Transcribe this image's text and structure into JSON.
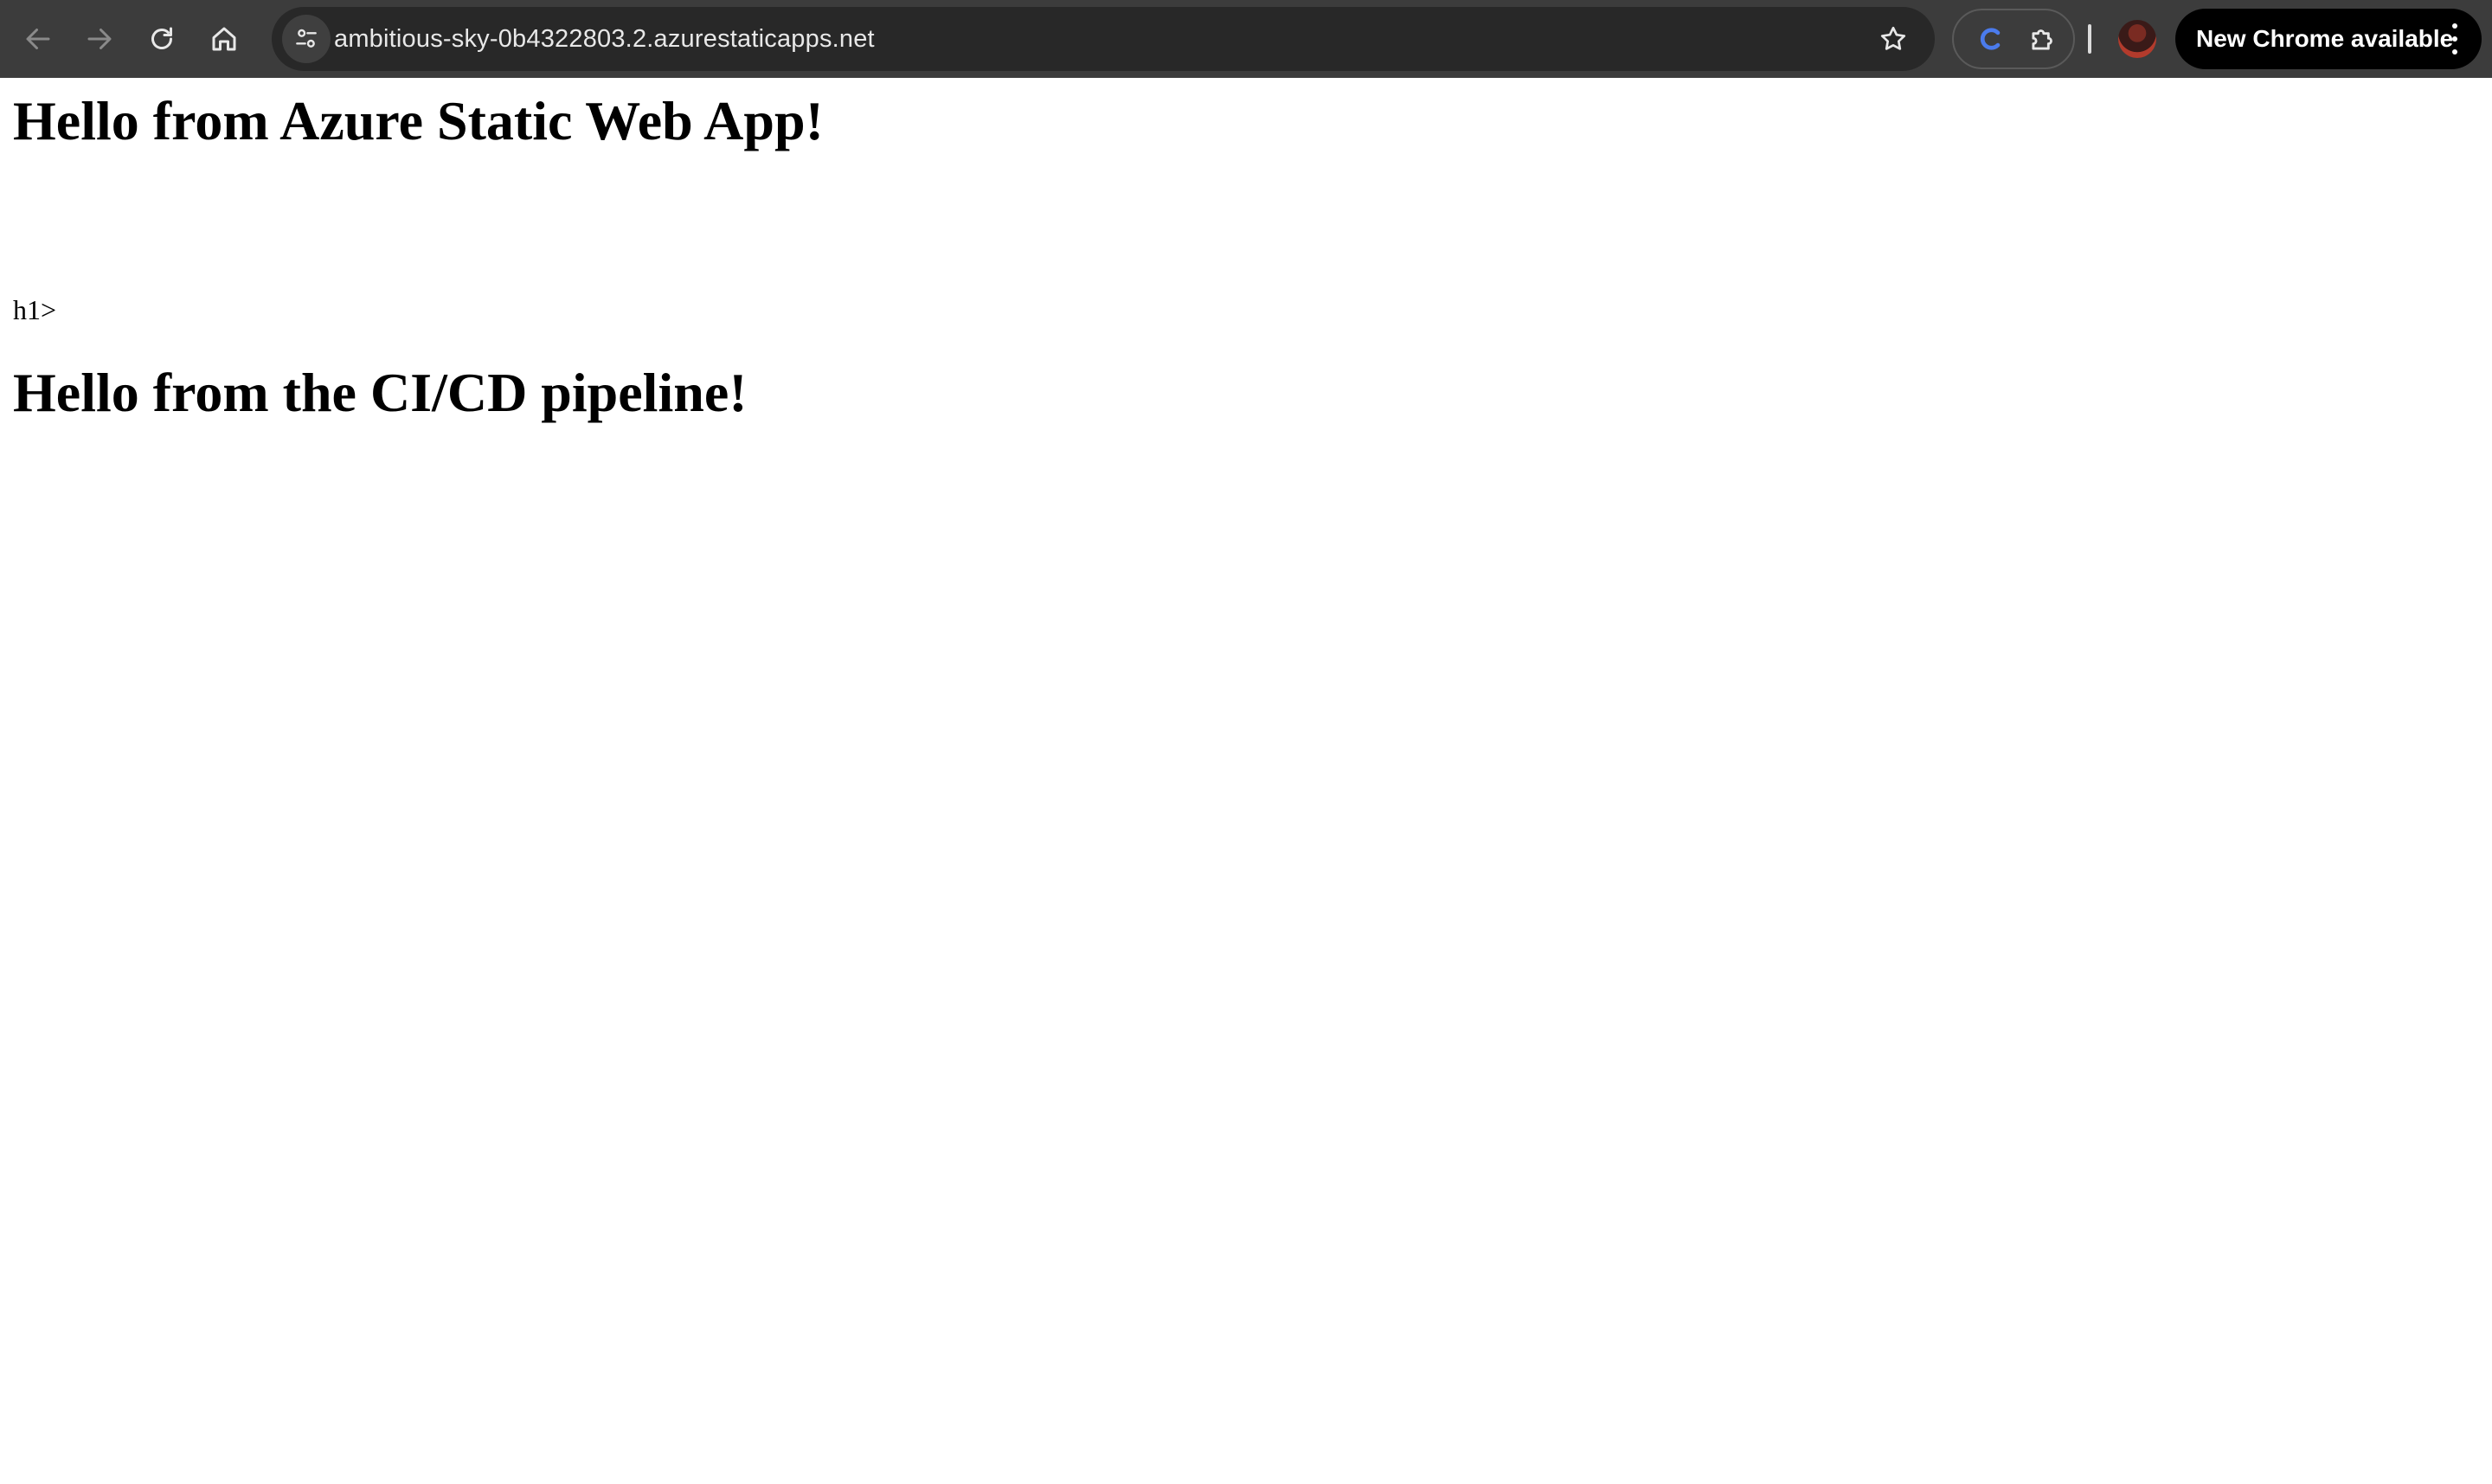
{
  "browser": {
    "url": "ambitious-sky-0b4322803.2.azurestaticapps.net",
    "update_button_label": "New Chrome available",
    "nav": {
      "back_icon": "arrow-left-icon",
      "forward_icon": "arrow-right-icon",
      "reload_icon": "reload-icon",
      "home_icon": "home-icon"
    },
    "icons": {
      "site_info": "tune-icon",
      "bookmark": "star-icon",
      "extension_c": "c-extension-icon",
      "extensions": "puzzle-icon",
      "profile": "avatar",
      "menu": "kebab-menu-icon"
    },
    "colors": {
      "toolbar_bg": "#3c3c3c",
      "omnibox_bg": "#282828",
      "update_button_bg": "#000000",
      "extension_c_color": "#4b7bec"
    }
  },
  "page": {
    "heading_1": "Hello from Azure Static Web App!",
    "stray_text": "h1>",
    "heading_2": "Hello from the CI/CD pipeline!"
  }
}
